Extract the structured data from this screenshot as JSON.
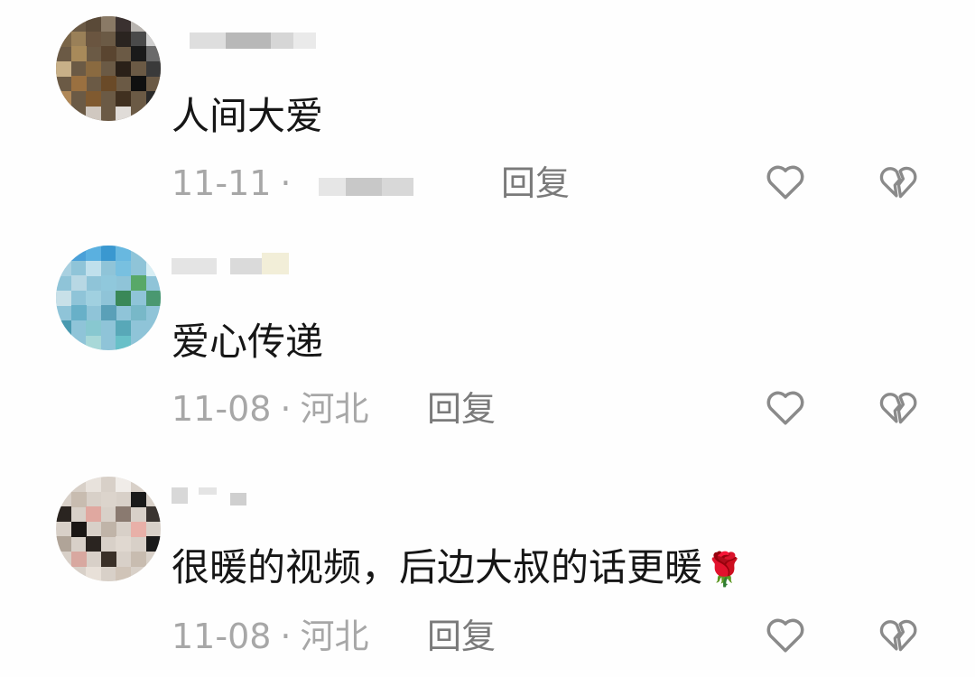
{
  "comments": [
    {
      "text": "人间大爱",
      "date": "11-11",
      "separator": "·",
      "location": "",
      "reply_label": "回复"
    },
    {
      "text": "爱心传递",
      "date": "11-08",
      "separator": "·",
      "location": "河北",
      "reply_label": "回复"
    },
    {
      "text": "很暖的视频，后边大叔的话更暖",
      "emoji": "🌹",
      "date": "11-08",
      "separator": "·",
      "location": "河北",
      "reply_label": "回复"
    }
  ],
  "icons": {
    "like": "heart-outline-icon",
    "dislike": "broken-heart-outline-icon"
  },
  "colors": {
    "text": "#161616",
    "meta": "#a7a7a7",
    "reply": "#7a7a7a",
    "icon": "#8a8a8a"
  }
}
